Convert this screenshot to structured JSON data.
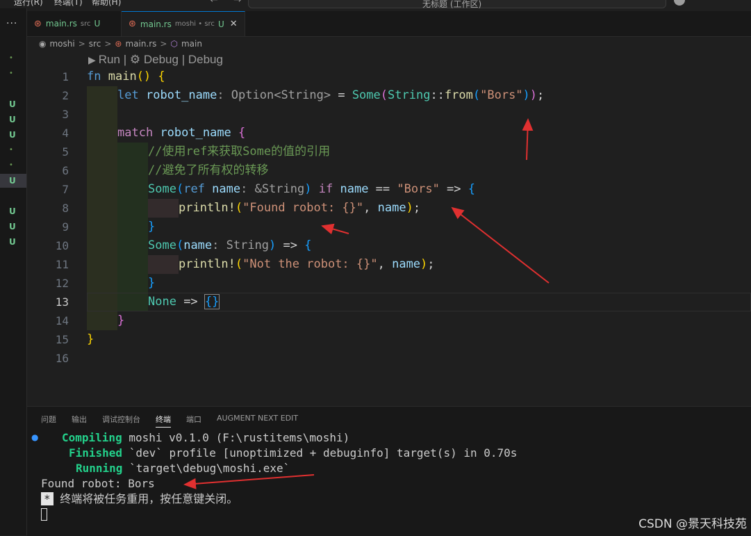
{
  "menu": {
    "items": [
      "运行(R)",
      "终端(T)",
      "帮助(H)"
    ],
    "nav_back": "←",
    "nav_fwd": "→",
    "command_center": "无标题 (工作区)"
  },
  "gutter": {
    "more": "···",
    "marks": [
      "•",
      "•",
      "U",
      "U",
      "U",
      "•",
      "•",
      "U",
      "U",
      "U",
      "U"
    ]
  },
  "tabs": [
    {
      "name": "main.rs",
      "desc": "src",
      "status": "U"
    },
    {
      "name": "main.rs",
      "desc": "moshi • src",
      "status": "U",
      "close": "✕"
    }
  ],
  "breadcrumb": {
    "root": "moshi",
    "folder": "src",
    "file": "main.rs",
    "symbol": "main",
    "sep": ">"
  },
  "codelens": {
    "run": "Run",
    "sep": "|",
    "debug1": "Debug",
    "debug2": "Debug"
  },
  "line_numbers": [
    "1",
    "2",
    "3",
    "4",
    "5",
    "6",
    "7",
    "8",
    "9",
    "10",
    "11",
    "12",
    "13",
    "14",
    "15",
    "16"
  ],
  "code": {
    "l1": {
      "fn": "fn",
      "name": "main",
      "paren": "()",
      "brace": "{"
    },
    "l2": {
      "let": "let",
      "var": "robot_name",
      "hint": ": Option<String>",
      "eq": " = ",
      "some": "Some",
      "p1": "(",
      "string": "String",
      "colons": "::",
      "from": "from",
      "p2": "(",
      "lit": "\"Bors\"",
      "p3": ")",
      "p4": ")",
      "semi": ";"
    },
    "l4": {
      "match": "match",
      "var": "robot_name",
      "brace": "{"
    },
    "l5": {
      "comment": "//使用ref来获取Some的值的引用"
    },
    "l6": {
      "comment": "//避免了所有权的转移"
    },
    "l7": {
      "some": "Some",
      "p1": "(",
      "ref": "ref",
      "name": "name",
      "hint": ": &String",
      "p2": ")",
      "if": "if",
      "name2": "name",
      "eq": " == ",
      "lit": "\"Bors\"",
      "arrow": " => ",
      "brace": "{"
    },
    "l8": {
      "mac": "println!",
      "p1": "(",
      "lit": "\"Found robot: {}\"",
      "comma": ", ",
      "name": "name",
      "p2": ")",
      "semi": ";"
    },
    "l9": {
      "brace": "}"
    },
    "l10": {
      "some": "Some",
      "p1": "(",
      "name": "name",
      "hint": ": String",
      "p2": ")",
      "arrow": " => ",
      "brace": "{"
    },
    "l11": {
      "mac": "println!",
      "p1": "(",
      "lit": "\"Not the robot: {}\"",
      "comma": ", ",
      "name": "name",
      "p2": ")",
      "semi": ";"
    },
    "l12": {
      "brace": "}"
    },
    "l13": {
      "none": "None",
      "arrow": " => ",
      "block": "{}"
    },
    "l14": {
      "brace": "}"
    },
    "l15": {
      "brace": "}"
    }
  },
  "panel": {
    "tabs": [
      "问题",
      "输出",
      "调试控制台",
      "终端",
      "端口",
      "AUGMENT NEXT EDIT"
    ],
    "active_tab": "终端"
  },
  "terminal": {
    "dot": "●",
    "compiling_label": "Compiling",
    "compiling_text": " moshi v0.1.0 (F:\\rustitems\\moshi)",
    "finished_label": "Finished",
    "finished_text": " `dev` profile [unoptimized + debuginfo] target(s) in 0.70s",
    "running_label": "Running",
    "running_text": " `target\\debug\\moshi.exe`",
    "output": "Found robot: Bors",
    "star": "*",
    "reuse_msg": "终端将被任务重用，按任意键关闭。"
  },
  "watermark": "CSDN @景天科技苑",
  "colors": {
    "accent": "#0078d4",
    "annotation_arrow": "#e03030",
    "untracked": "#73c991"
  }
}
